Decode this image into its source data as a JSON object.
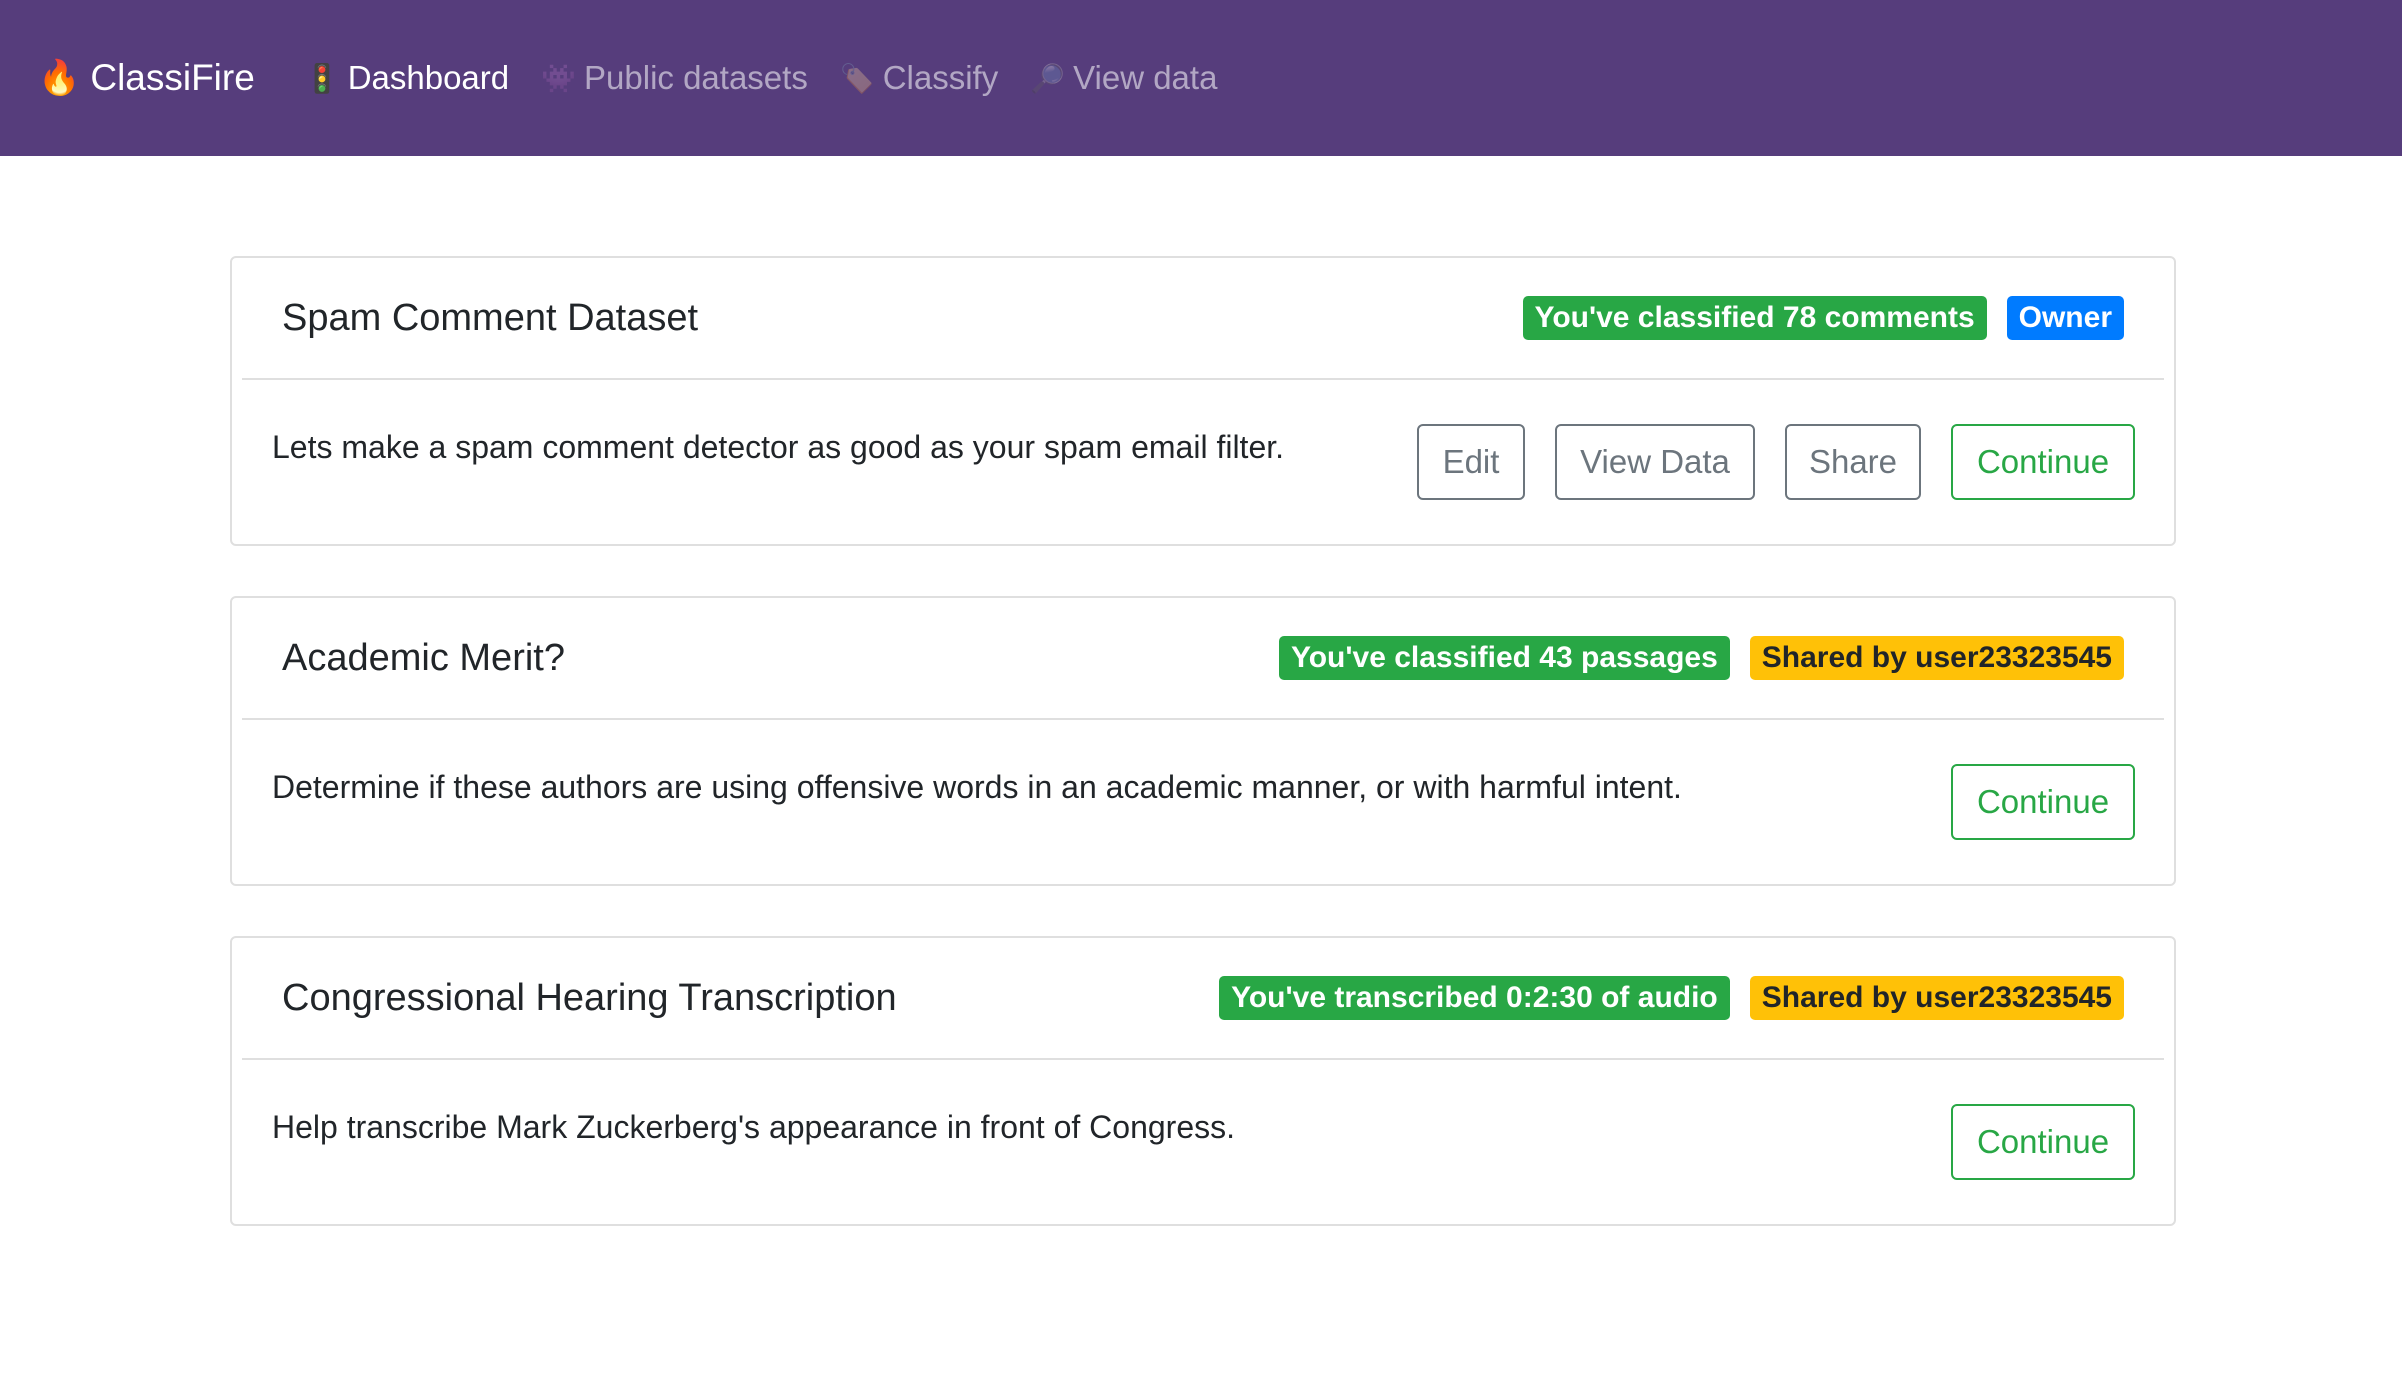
{
  "navbar": {
    "brand_emoji": "🔥",
    "brand": "ClassiFire",
    "links": [
      {
        "emoji": "🚦",
        "label": "Dashboard",
        "active": true
      },
      {
        "emoji": "👾",
        "label": "Public datasets",
        "active": false
      },
      {
        "emoji": "🏷️",
        "label": "Classify",
        "active": false
      },
      {
        "emoji": "🔎",
        "label": "View data",
        "active": false
      }
    ]
  },
  "cards": [
    {
      "title": "Spam Comment Dataset",
      "progress_badge": "You've classified 78 comments",
      "role_badge": "Owner",
      "description": "Lets make a spam comment detector as good as your spam email filter.",
      "edit_label": "Edit",
      "view_data_label": "View Data",
      "share_label": "Share",
      "continue_label": "Continue"
    },
    {
      "title": "Academic Merit?",
      "progress_badge": "You've classified 43 passages",
      "role_badge": "Shared by user23323545",
      "description": "Determine if these authors are using offensive words in an academic manner, or with harmful intent.",
      "continue_label": "Continue"
    },
    {
      "title": "Congressional Hearing Transcription",
      "progress_badge": "You've transcribed 0:2:30 of audio",
      "role_badge": "Shared by user23323545",
      "description": "Help transcribe Mark Zuckerberg's appearance in front of Congress.",
      "continue_label": "Continue"
    }
  ],
  "colors": {
    "navbar_bg": "#563d7c",
    "success": "#28a745",
    "primary": "#007bff",
    "warning": "#ffc107",
    "secondary": "#6c757d"
  }
}
